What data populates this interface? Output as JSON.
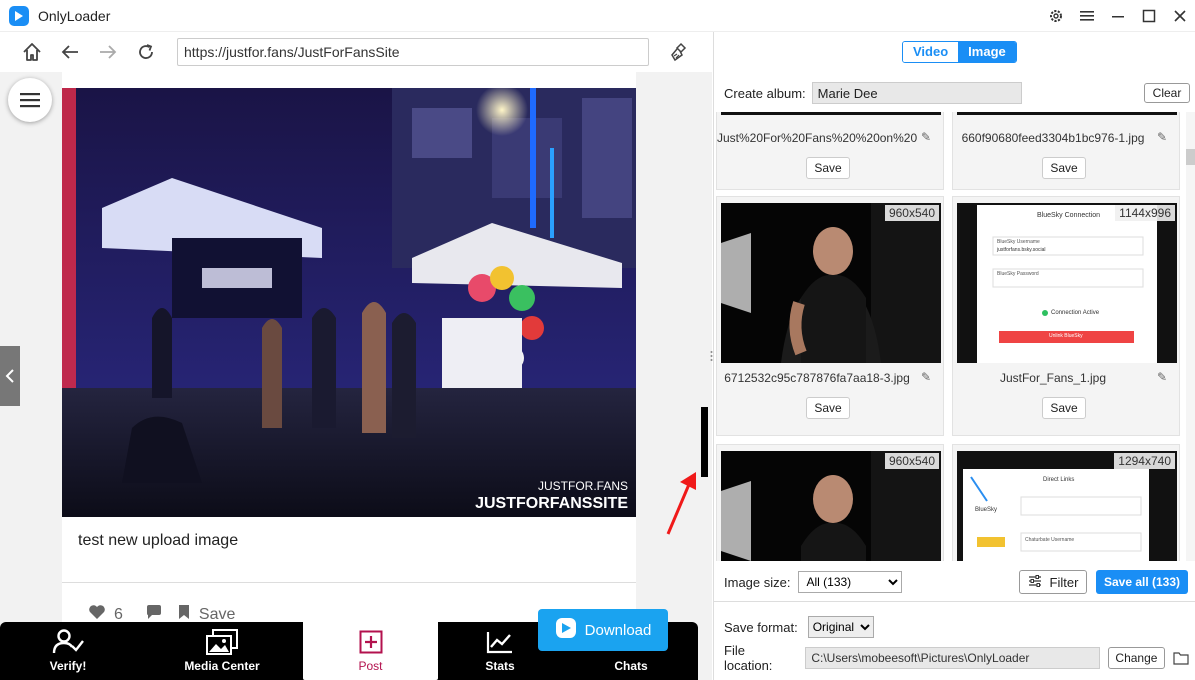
{
  "app": {
    "title": "OnlyLoader"
  },
  "browser": {
    "url": "https://justfor.fans/JustForFansSite"
  },
  "post": {
    "caption": "test new upload image",
    "likes": "6",
    "save_label": "Save",
    "watermark_line1": "JUSTFOR.FANS",
    "watermark_line2": "JUSTFORFANSSITE"
  },
  "bottom_nav": {
    "verify": "Verify!",
    "media_center": "Media Center",
    "post": "Post",
    "stats": "Stats",
    "chats": "Chats",
    "download": "Download"
  },
  "panel": {
    "tabs": {
      "video": "Video",
      "image": "Image"
    },
    "create_album_label": "Create album:",
    "album_value": "Marie Dee",
    "clear_label": "Clear",
    "items": [
      {
        "filename": "Just%20For%20Fans%20%20on%20",
        "save": "Save"
      },
      {
        "filename": "660f90680feed3304b1bc976-1.jpg",
        "save": "Save"
      },
      {
        "filename": "6712532c95c787876fa7aa18-3.jpg",
        "save": "Save",
        "dims": "960x540"
      },
      {
        "filename": "JustFor_Fans_1.jpg",
        "save": "Save",
        "dims": "1144x996"
      },
      {
        "dims": "960x540"
      },
      {
        "dims": "1294x740"
      }
    ],
    "screenshot_texts": {
      "bluesky_title": "BlueSky Connection",
      "bluesky_username": "BlueSky Username",
      "bluesky_username_value": "justforfans.bsky.social",
      "bluesky_password": "BlueSky Password",
      "connection_active": "Connection Active",
      "unlink": "Unlink BlueSky",
      "direct_links": "Direct Links",
      "bluesky": "BlueSky",
      "chaturbate_username": "Chaturbate Username"
    },
    "image_size_label": "Image size:",
    "image_size_value": "All (133)",
    "filter_label": "Filter",
    "save_all_label": "Save all (133)",
    "save_format_label": "Save format:",
    "save_format_value": "Original",
    "file_location_label": "File location:",
    "file_location_value": "C:\\Users\\mobeesoft\\Pictures\\OnlyLoader",
    "change_label": "Change"
  }
}
